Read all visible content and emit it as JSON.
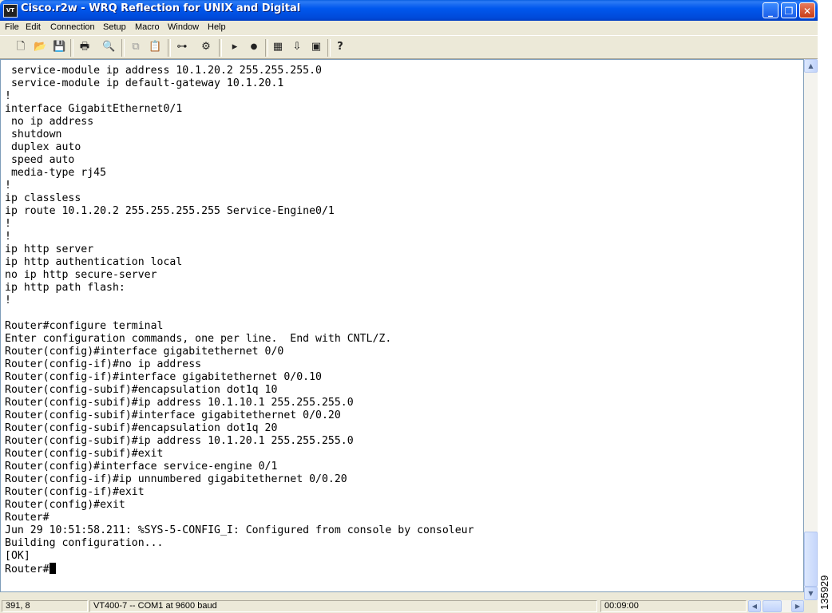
{
  "window": {
    "title": "Cisco.r2w - WRQ Reflection for UNIX and Digital",
    "app_icon_label": "VT",
    "minimize_glyph": "_",
    "maximize_glyph": "❐",
    "close_glyph": "✕"
  },
  "menu": {
    "items": [
      {
        "label": "File"
      },
      {
        "label": "Edit"
      },
      {
        "label": "Connection"
      },
      {
        "label": "Setup"
      },
      {
        "label": "Macro"
      },
      {
        "label": "Window"
      },
      {
        "label": "Help"
      }
    ]
  },
  "toolbar": {
    "icons": [
      {
        "name": "new-icon",
        "glyph": "🗋"
      },
      {
        "name": "open-icon",
        "glyph": "📂"
      },
      {
        "name": "save-icon",
        "glyph": "💾"
      },
      {
        "name": "print-icon",
        "glyph": "🖶"
      },
      {
        "name": "find-icon",
        "glyph": "🔍"
      },
      {
        "name": "copy-icon",
        "glyph": "⧉"
      },
      {
        "name": "paste-icon",
        "glyph": "📋"
      },
      {
        "name": "connect-icon",
        "glyph": "⊶"
      },
      {
        "name": "setup-icon",
        "glyph": "⚙"
      },
      {
        "name": "play-icon",
        "glyph": "▸"
      },
      {
        "name": "record-icon",
        "glyph": "●"
      },
      {
        "name": "window-icon",
        "glyph": "▦"
      },
      {
        "name": "transfer-icon",
        "glyph": "⇩"
      },
      {
        "name": "display-icon",
        "glyph": "▣"
      },
      {
        "name": "help-icon",
        "glyph": "?"
      }
    ]
  },
  "terminal": {
    "lines": [
      " service-module ip address 10.1.20.2 255.255.255.0",
      " service-module ip default-gateway 10.1.20.1",
      "!",
      "interface GigabitEthernet0/1",
      " no ip address",
      " shutdown",
      " duplex auto",
      " speed auto",
      " media-type rj45",
      "!",
      "ip classless",
      "ip route 10.1.20.2 255.255.255.255 Service-Engine0/1",
      "!",
      "!",
      "ip http server",
      "ip http authentication local",
      "no ip http secure-server",
      "ip http path flash:",
      "!",
      "",
      "Router#configure terminal",
      "Enter configuration commands, one per line.  End with CNTL/Z.",
      "Router(config)#interface gigabitethernet 0/0",
      "Router(config-if)#no ip address",
      "Router(config-if)#interface gigabitethernet 0/0.10",
      "Router(config-subif)#encapsulation dot1q 10",
      "Router(config-subif)#ip address 10.1.10.1 255.255.255.0",
      "Router(config-subif)#interface gigabitethernet 0/0.20",
      "Router(config-subif)#encapsulation dot1q 20",
      "Router(config-subif)#ip address 10.1.20.1 255.255.255.0",
      "Router(config-subif)#exit",
      "Router(config)#interface service-engine 0/1",
      "Router(config-if)#ip unnumbered gigabitethernet 0/0.20",
      "Router(config-if)#exit",
      "Router(config)#exit",
      "Router#",
      "Jun 29 10:51:58.211: %SYS-5-CONFIG_I: Configured from console by consoleur",
      "Building configuration...",
      "[OK]"
    ],
    "prompt": "Router#"
  },
  "statusbar": {
    "cursor_position": "391, 8",
    "connection": "VT400-7 -- COM1 at 9600 baud",
    "elapsed": "00:09:00"
  },
  "figure_number": "135929"
}
